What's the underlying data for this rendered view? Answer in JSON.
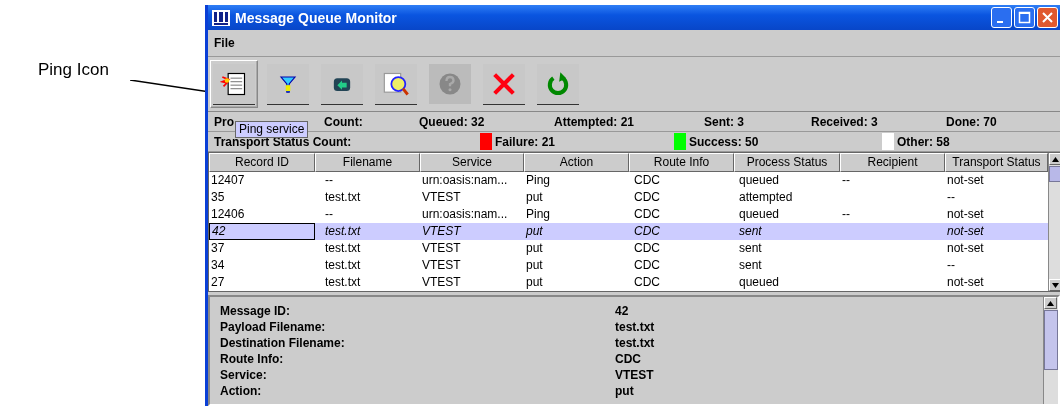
{
  "annotation": {
    "label": "Ping Icon"
  },
  "window": {
    "title": "Message Queue Monitor"
  },
  "menu": [
    {
      "label": "File"
    }
  ],
  "toolbar": [
    {
      "kind": "ping",
      "pressed": true,
      "disabled": false
    },
    {
      "kind": "filter",
      "pressed": false,
      "disabled": false
    },
    {
      "kind": "reply",
      "pressed": false,
      "disabled": false
    },
    {
      "kind": "find",
      "pressed": false,
      "disabled": false
    },
    {
      "kind": "help",
      "pressed": false,
      "disabled": true
    },
    {
      "kind": "delete",
      "pressed": false,
      "disabled": false
    },
    {
      "kind": "refresh",
      "pressed": false,
      "disabled": false
    }
  ],
  "tooltip": "Ping service",
  "process_counts": {
    "label_parts": [
      "Pro",
      "Count:"
    ],
    "items": [
      "Queued: 32",
      "Attempted: 21",
      "Sent: 3",
      "Received: 3",
      "Done: 70"
    ]
  },
  "transport_counts": {
    "label": "Transport Status Count:",
    "items": [
      {
        "text": "Failure: 21",
        "color": "#ff0000"
      },
      {
        "text": "Success: 50",
        "color": "#00ff00"
      },
      {
        "text": "Other: 58",
        "color": "#ffffff"
      }
    ]
  },
  "table": {
    "columns": [
      "Record ID",
      "Filename",
      "Service",
      "Action",
      "Route Info",
      "Process Status",
      "Recipient",
      "Transport Status"
    ],
    "rows": [
      {
        "selected": false,
        "cells": [
          "12407",
          "--",
          "urn:oasis:nam...",
          "Ping",
          "CDC",
          "queued",
          "--",
          "not-set"
        ]
      },
      {
        "selected": false,
        "cells": [
          "35",
          "test.txt",
          "VTEST",
          "put",
          "CDC",
          "attempted",
          "",
          "--"
        ]
      },
      {
        "selected": false,
        "cells": [
          "12406",
          "--",
          "urn:oasis:nam...",
          "Ping",
          "CDC",
          "queued",
          "--",
          "not-set"
        ]
      },
      {
        "selected": true,
        "cells": [
          "42",
          "test.txt",
          "VTEST",
          "put",
          "CDC",
          "sent",
          "",
          "not-set"
        ]
      },
      {
        "selected": false,
        "cells": [
          "37",
          "test.txt",
          "VTEST",
          "put",
          "CDC",
          "sent",
          "",
          "not-set"
        ]
      },
      {
        "selected": false,
        "cells": [
          "34",
          "test.txt",
          "VTEST",
          "put",
          "CDC",
          "sent",
          "",
          "--"
        ]
      },
      {
        "selected": false,
        "cells": [
          "27",
          "test.txt",
          "VTEST",
          "put",
          "CDC",
          "queued",
          "",
          "not-set"
        ]
      }
    ]
  },
  "details": [
    {
      "label": "Message ID:",
      "value": "42"
    },
    {
      "label": "Payload Filename:",
      "value": "test.txt"
    },
    {
      "label": "Destination Filename:",
      "value": "test.txt"
    },
    {
      "label": "Route Info:",
      "value": "CDC"
    },
    {
      "label": "Service:",
      "value": "VTEST"
    },
    {
      "label": "Action:",
      "value": "put"
    }
  ]
}
